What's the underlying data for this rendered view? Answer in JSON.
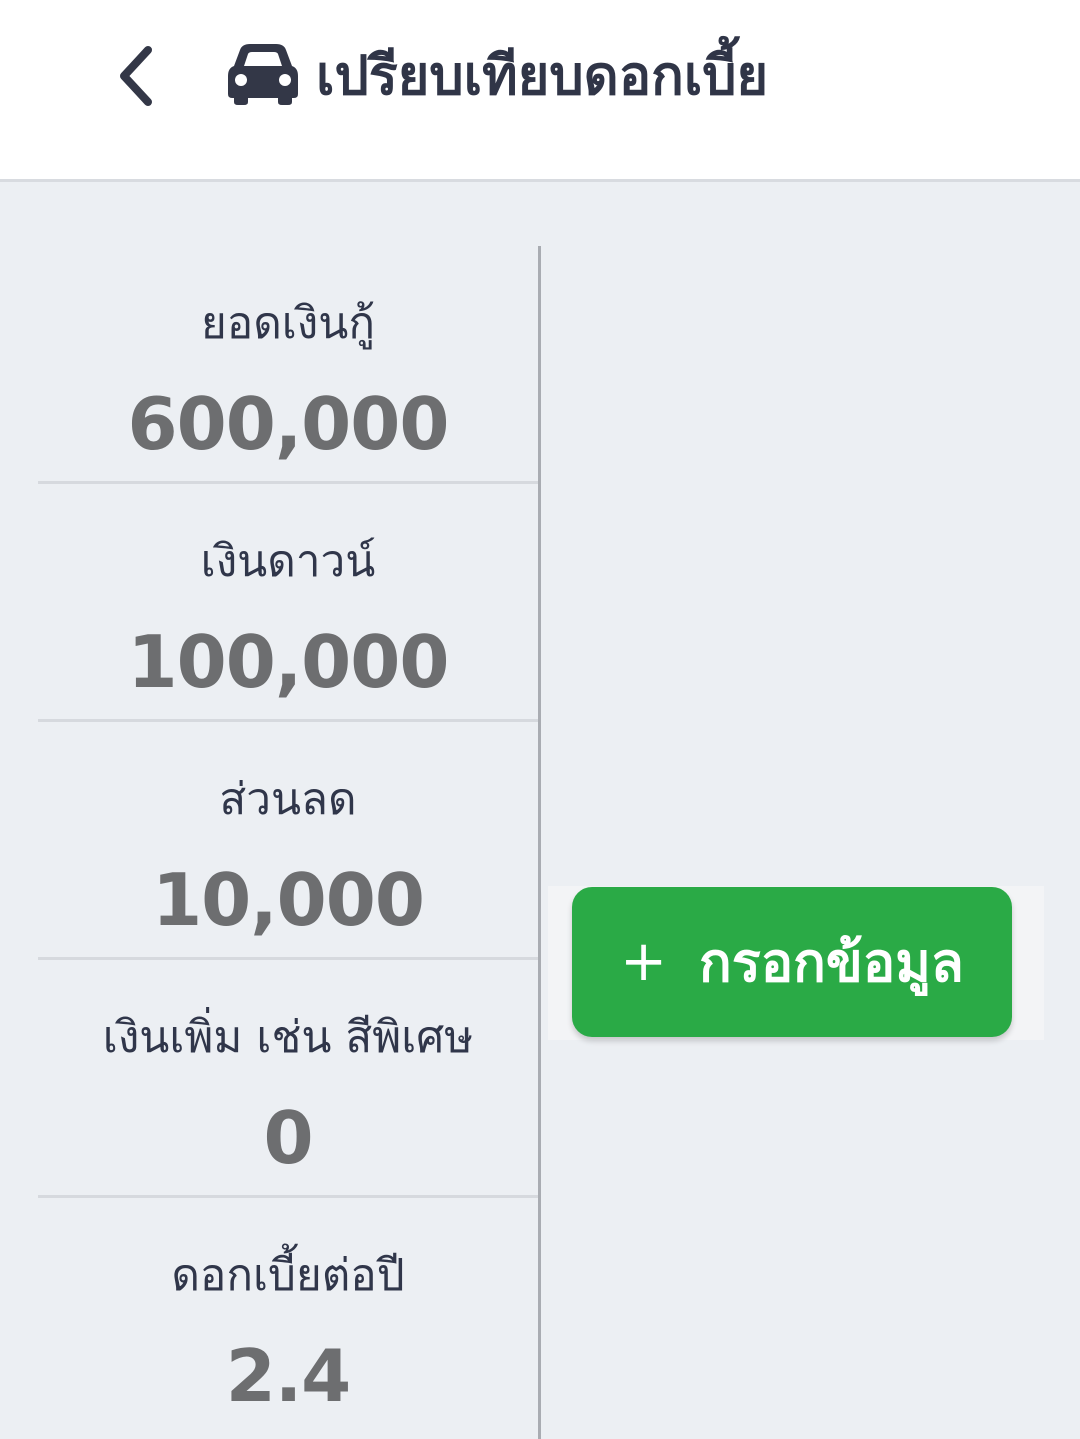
{
  "header": {
    "title": "เปรียบเทียบดอกเบี้ย",
    "back_icon": "chevron-left-icon",
    "title_icon": "car-icon"
  },
  "loan_details": [
    {
      "label": "ยอดเงินกู้",
      "value": "600,000"
    },
    {
      "label": "เงินดาวน์",
      "value": "100,000"
    },
    {
      "label": "ส่วนลด",
      "value": "10,000"
    },
    {
      "label": "เงินเพิ่ม เช่น สีพิเศษ",
      "value": "0"
    },
    {
      "label": "ดอกเบี้ยต่อปี",
      "value": "2.4"
    }
  ],
  "add_button": {
    "icon": "+",
    "label": "กรอกข้อมูล",
    "color": "#2aaa46"
  },
  "colors": {
    "header_bg": "#ffffff",
    "page_bg": "#eceff3",
    "label_text": "#30364a",
    "value_text": "#6d6e70"
  }
}
